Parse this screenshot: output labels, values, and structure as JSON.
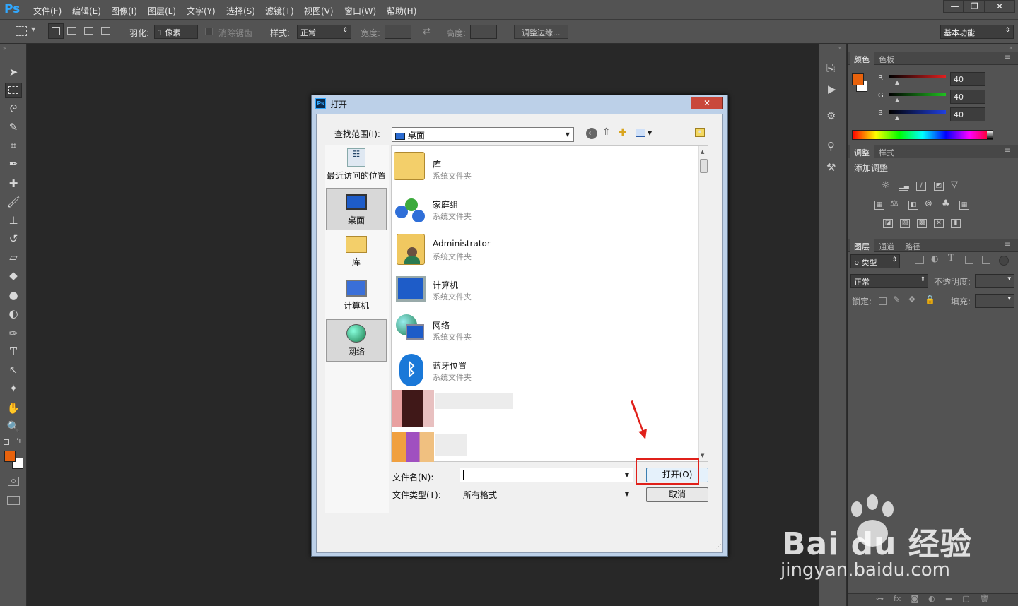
{
  "app": {
    "logo": "Ps"
  },
  "menu": [
    "文件(F)",
    "编辑(E)",
    "图像(I)",
    "图层(L)",
    "文字(Y)",
    "选择(S)",
    "滤镜(T)",
    "视图(V)",
    "窗口(W)",
    "帮助(H)"
  ],
  "window_controls": {
    "minimize": "—",
    "restore": "❐",
    "close": "✕"
  },
  "options_bar": {
    "feather_label": "羽化:",
    "feather_value": "1 像素",
    "antialias_label": "消除锯齿",
    "style_label": "样式:",
    "style_value": "正常",
    "width_label": "宽度:",
    "height_label": "高度:",
    "refine_edge": "调整边缘...",
    "workspace": "基本功能"
  },
  "color_panel": {
    "tabs": [
      "颜色",
      "色板"
    ],
    "channels": [
      {
        "name": "R",
        "value": "40",
        "color": "#e02020"
      },
      {
        "name": "G",
        "value": "40",
        "color": "#20c020"
      },
      {
        "name": "B",
        "value": "40",
        "color": "#2040e0"
      }
    ],
    "foreground": "#e8620c"
  },
  "adjust_panel": {
    "tabs": [
      "调整",
      "样式"
    ],
    "heading": "添加调整"
  },
  "layers_panel": {
    "tabs": [
      "图层",
      "通道",
      "路径"
    ],
    "filter": "ρ 类型",
    "blend": "正常",
    "opacity_label": "不透明度:",
    "lock_label": "锁定:",
    "fill_label": "填充:"
  },
  "dialog": {
    "title": "打开",
    "lookin_label": "查找范围(I):",
    "lookin_value": "桌面",
    "nav": [
      {
        "label": "最近访问的位置",
        "icon": "recent-places-icon"
      },
      {
        "label": "桌面",
        "icon": "desktop-icon"
      },
      {
        "label": "库",
        "icon": "library-icon"
      },
      {
        "label": "计算机",
        "icon": "computer-icon"
      },
      {
        "label": "网络",
        "icon": "network-icon"
      }
    ],
    "files": [
      {
        "name": "库",
        "type": "系统文件夹",
        "icon": "library-folder-icon"
      },
      {
        "name": "家庭组",
        "type": "系统文件夹",
        "icon": "homegroup-icon"
      },
      {
        "name": "Administrator",
        "type": "系统文件夹",
        "icon": "user-folder-icon"
      },
      {
        "name": "计算机",
        "type": "系统文件夹",
        "icon": "computer-icon"
      },
      {
        "name": "网络",
        "type": "系统文件夹",
        "icon": "network-icon"
      },
      {
        "name": "蓝牙位置",
        "type": "系统文件夹",
        "icon": "bluetooth-icon"
      }
    ],
    "filename_label": "文件名(N):",
    "filename_value": "",
    "filetype_label": "文件类型(T):",
    "filetype_value": "所有格式",
    "open_button": "打开(O)",
    "cancel_button": "取消"
  },
  "watermark": {
    "brand": "Bai du 经验",
    "url": "jingyan.baidu.com"
  }
}
